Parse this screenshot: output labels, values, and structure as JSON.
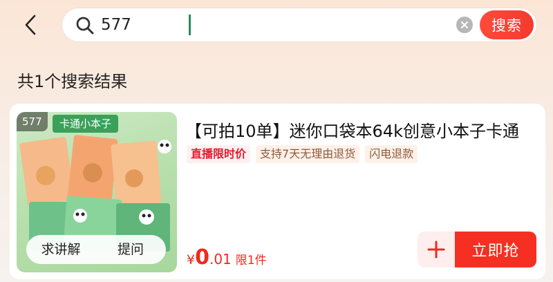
{
  "header": {
    "back_icon": "chevron-left-icon",
    "search": {
      "value": "577",
      "placeholder": "",
      "search_icon": "search-icon",
      "clear_icon": "close-circle-icon",
      "button_label": "搜索"
    }
  },
  "results": {
    "count_label": "共1个搜索结果"
  },
  "product": {
    "thumb_badge": "577",
    "thumb_banner": "卡通小本子",
    "explain_label": "求讲解",
    "ask_label": "提问",
    "title": "【可拍10单】迷你口袋本64k创意小本子卡通",
    "tags": [
      {
        "label": "直播限时价",
        "type": "live"
      },
      {
        "label": "支持7天无理由退货",
        "type": "service"
      },
      {
        "label": "闪电退款",
        "type": "service"
      }
    ],
    "price_symbol": "¥",
    "price_integer": "0",
    "price_decimal": ".01",
    "limit_label": "限1件",
    "cart_icon": "plus-icon",
    "buy_label": "立即抢"
  },
  "colors": {
    "accent": "#f52f21",
    "price": "#ee2a1e",
    "caret": "#2c8a64"
  }
}
